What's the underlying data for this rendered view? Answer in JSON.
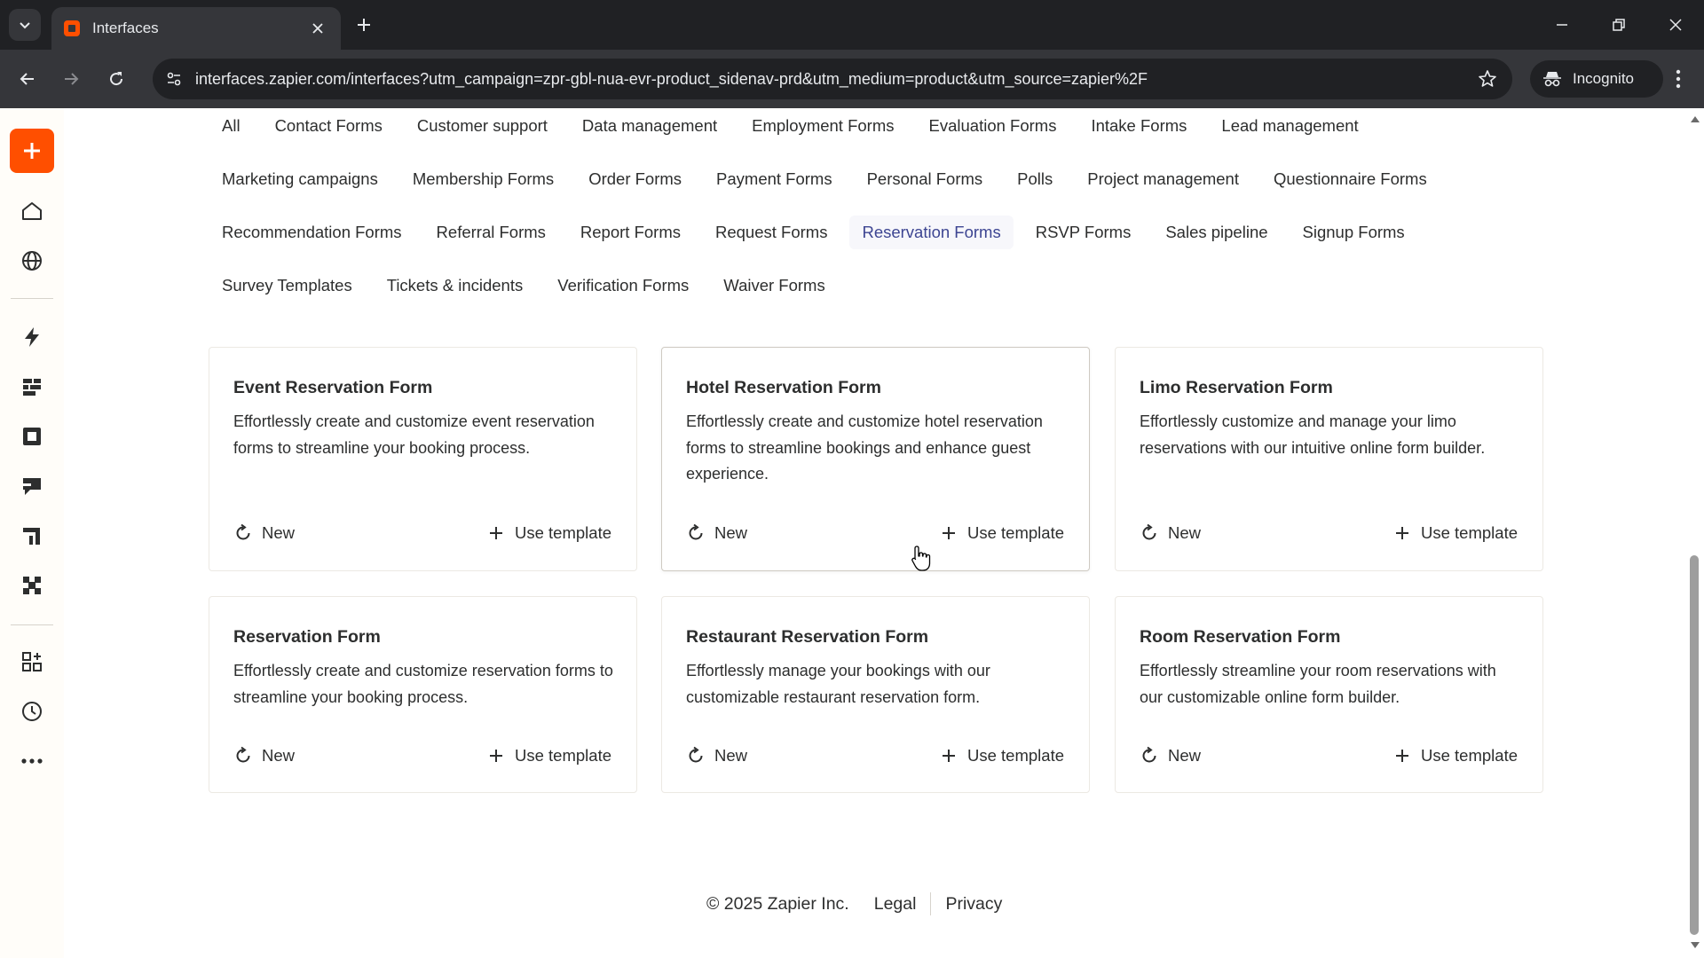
{
  "browser": {
    "tab_title": "Interfaces",
    "url": "interfaces.zapier.com/interfaces?utm_campaign=zpr-gbl-nua-evr-product_sidenav-prd&utm_medium=product&utm_source=zapier%2F",
    "incognito_label": "Incognito"
  },
  "sidebar": {
    "icons": [
      "create-icon",
      "home-icon",
      "globe-icon",
      "zap-icon",
      "tables-icon",
      "interfaces-icon",
      "chatbots-icon",
      "canvas-icon",
      "agents-icon",
      "apps-icon",
      "history-icon",
      "more-icon"
    ]
  },
  "categories": {
    "row1": [
      "All",
      "Contact Forms",
      "Customer support",
      "Data management",
      "Employment Forms",
      "Evaluation Forms",
      "Intake Forms",
      "Lead management"
    ],
    "row2": [
      "Marketing campaigns",
      "Membership Forms",
      "Order Forms",
      "Payment Forms",
      "Personal Forms",
      "Polls",
      "Project management",
      "Questionnaire Forms"
    ],
    "row3": [
      "Recommendation Forms",
      "Referral Forms",
      "Report Forms",
      "Request Forms",
      "Reservation Forms",
      "RSVP Forms",
      "Sales pipeline",
      "Signup Forms"
    ],
    "row4": [
      "Survey Templates",
      "Tickets & incidents",
      "Verification Forms",
      "Waiver Forms"
    ],
    "active": "Reservation Forms"
  },
  "cards": [
    {
      "title": "Event Reservation Form",
      "description": "Effortlessly create and customize event reservation forms to streamline your booking process.",
      "new_label": "New",
      "use_label": "Use template"
    },
    {
      "title": "Hotel Reservation Form",
      "description": "Effortlessly create and customize hotel reservation forms to streamline bookings and enhance guest experience.",
      "new_label": "New",
      "use_label": "Use template"
    },
    {
      "title": "Limo Reservation Form",
      "description": "Effortlessly customize and manage your limo reservations with our intuitive online form builder.",
      "new_label": "New",
      "use_label": "Use template"
    },
    {
      "title": "Reservation Form",
      "description": "Effortlessly create and customize reservation forms to streamline your booking process.",
      "new_label": "New",
      "use_label": "Use template"
    },
    {
      "title": "Restaurant Reservation Form",
      "description": "Effortlessly manage your bookings with our customizable restaurant reservation form.",
      "new_label": "New",
      "use_label": "Use template"
    },
    {
      "title": "Room Reservation Form",
      "description": "Effortlessly streamline your room reservations with our customizable online form builder.",
      "new_label": "New",
      "use_label": "Use template"
    }
  ],
  "footer": {
    "copyright": "© 2025 Zapier Inc.",
    "legal": "Legal",
    "privacy": "Privacy"
  },
  "colors": {
    "brand": "#ff4f00",
    "active_category": "#3d4592",
    "chrome_dark": "#202124",
    "chrome_mid": "#35363a"
  }
}
